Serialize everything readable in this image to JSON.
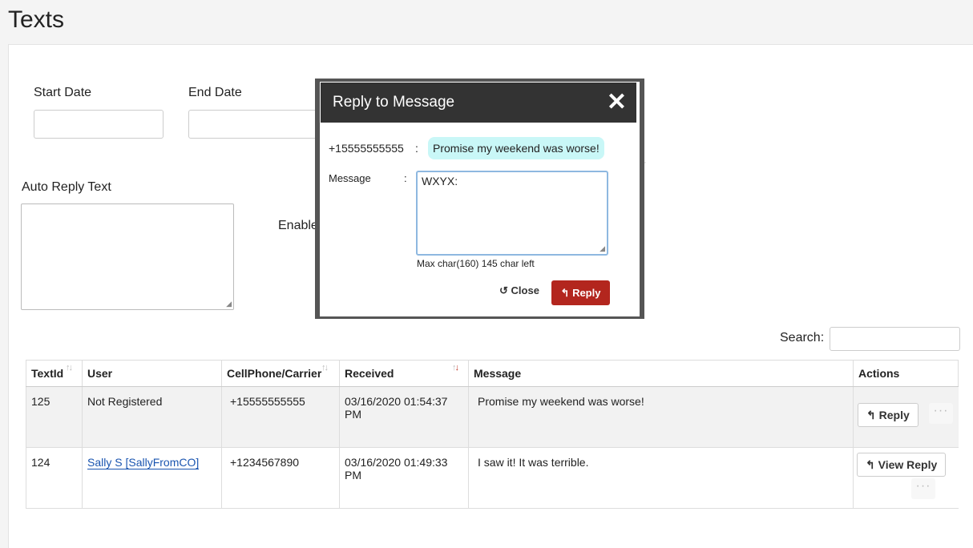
{
  "page_title": "Texts",
  "filters": {
    "start_date_label": "Start Date",
    "end_date_label": "End Date",
    "auto_reply_label": "Auto Reply Text",
    "enable_label_partial": "Enable"
  },
  "search": {
    "label": "Search:",
    "value": ""
  },
  "table": {
    "columns": [
      "TextId",
      "User",
      "CellPhone/Carrier",
      "Received",
      "Message",
      "Actions"
    ],
    "rows": [
      {
        "text_id": "125",
        "user": "Not Registered",
        "cellphone": "+15555555555",
        "received": "03/16/2020 01:54:37 PM",
        "message": "Promise my weekend was worse!",
        "action_label": "Reply"
      },
      {
        "text_id": "124",
        "user": "Sally S [SallyFromCO]",
        "cellphone": "+1234567890",
        "received": "03/16/2020 01:49:33 PM",
        "message": "I saw it! It was terrible.",
        "action_label": "View Reply"
      }
    ]
  },
  "modal": {
    "title": "Reply to Message",
    "close_glyph": "✕",
    "phone": "+15555555555",
    "separator": ":",
    "incoming_message": "Promise my weekend was worse!",
    "message_label": "Message",
    "message_value": "WXYX:",
    "char_counter": "Max char(160) 145 char left",
    "close_button": "Close",
    "reply_button": "Reply"
  },
  "icons": {
    "sort": "sort-icon",
    "reply": "reply-icon",
    "undo": "undo-icon",
    "more": "more-dots-icon"
  },
  "colors": {
    "reply_button": "#b3261e",
    "modal_header": "#333333",
    "bubble": "#c9f7f7",
    "link": "#1a55b0"
  }
}
